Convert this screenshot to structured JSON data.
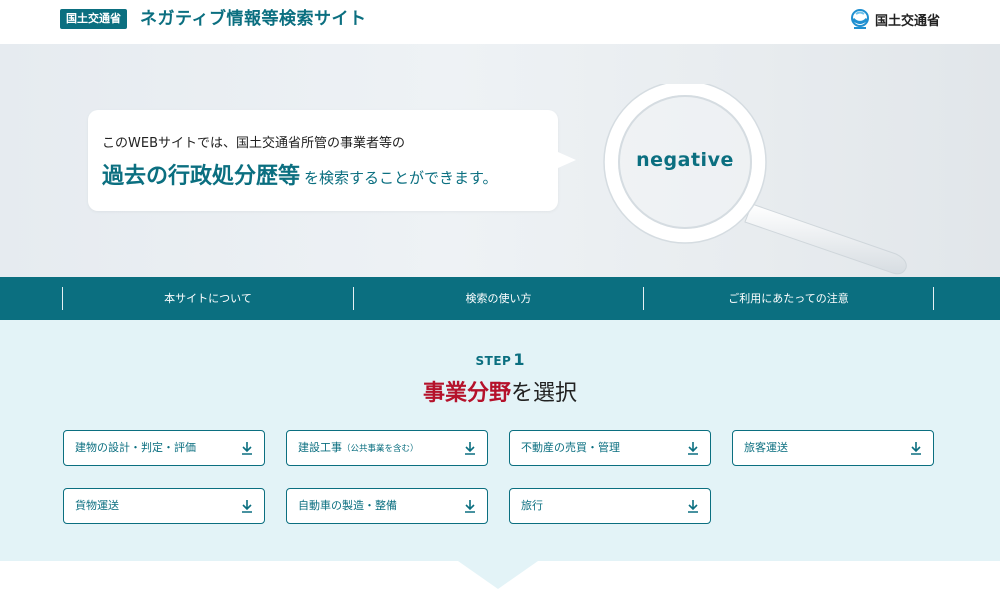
{
  "header": {
    "badge": "国土交通省",
    "title": "ネガティブ情報等検索サイト",
    "logo_text": "国土交通省",
    "logo_icon": "mlit-logo-icon"
  },
  "hero": {
    "line1": "このWEBサイトでは、国土交通省所管の事業者等の",
    "strong": "過去の行政処分歴等",
    "rest": "を検索することができます。",
    "lens_word": "negative"
  },
  "nav": {
    "items": [
      {
        "label": "本サイトについて"
      },
      {
        "label": "検索の使い方"
      },
      {
        "label": "ご利用にあたっての注意"
      }
    ]
  },
  "step": {
    "word": "STEP",
    "number": "1",
    "title_accent": "事業分野",
    "title_rest": "を選択",
    "fields": [
      {
        "label": "建物の設計・判定・評価",
        "note": ""
      },
      {
        "label": "建設工事",
        "note": "（公共事業を含む）"
      },
      {
        "label": "不動産の売買・管理",
        "note": ""
      },
      {
        "label": "旅客運送",
        "note": ""
      },
      {
        "label": "貨物運送",
        "note": ""
      },
      {
        "label": "自動車の製造・整備",
        "note": ""
      },
      {
        "label": "旅行",
        "note": ""
      }
    ],
    "arrow_icon": "down-arrow-icon"
  },
  "colors": {
    "primary": "#0b6f80",
    "accent": "#b5122b",
    "section_bg": "#e3f3f7"
  }
}
